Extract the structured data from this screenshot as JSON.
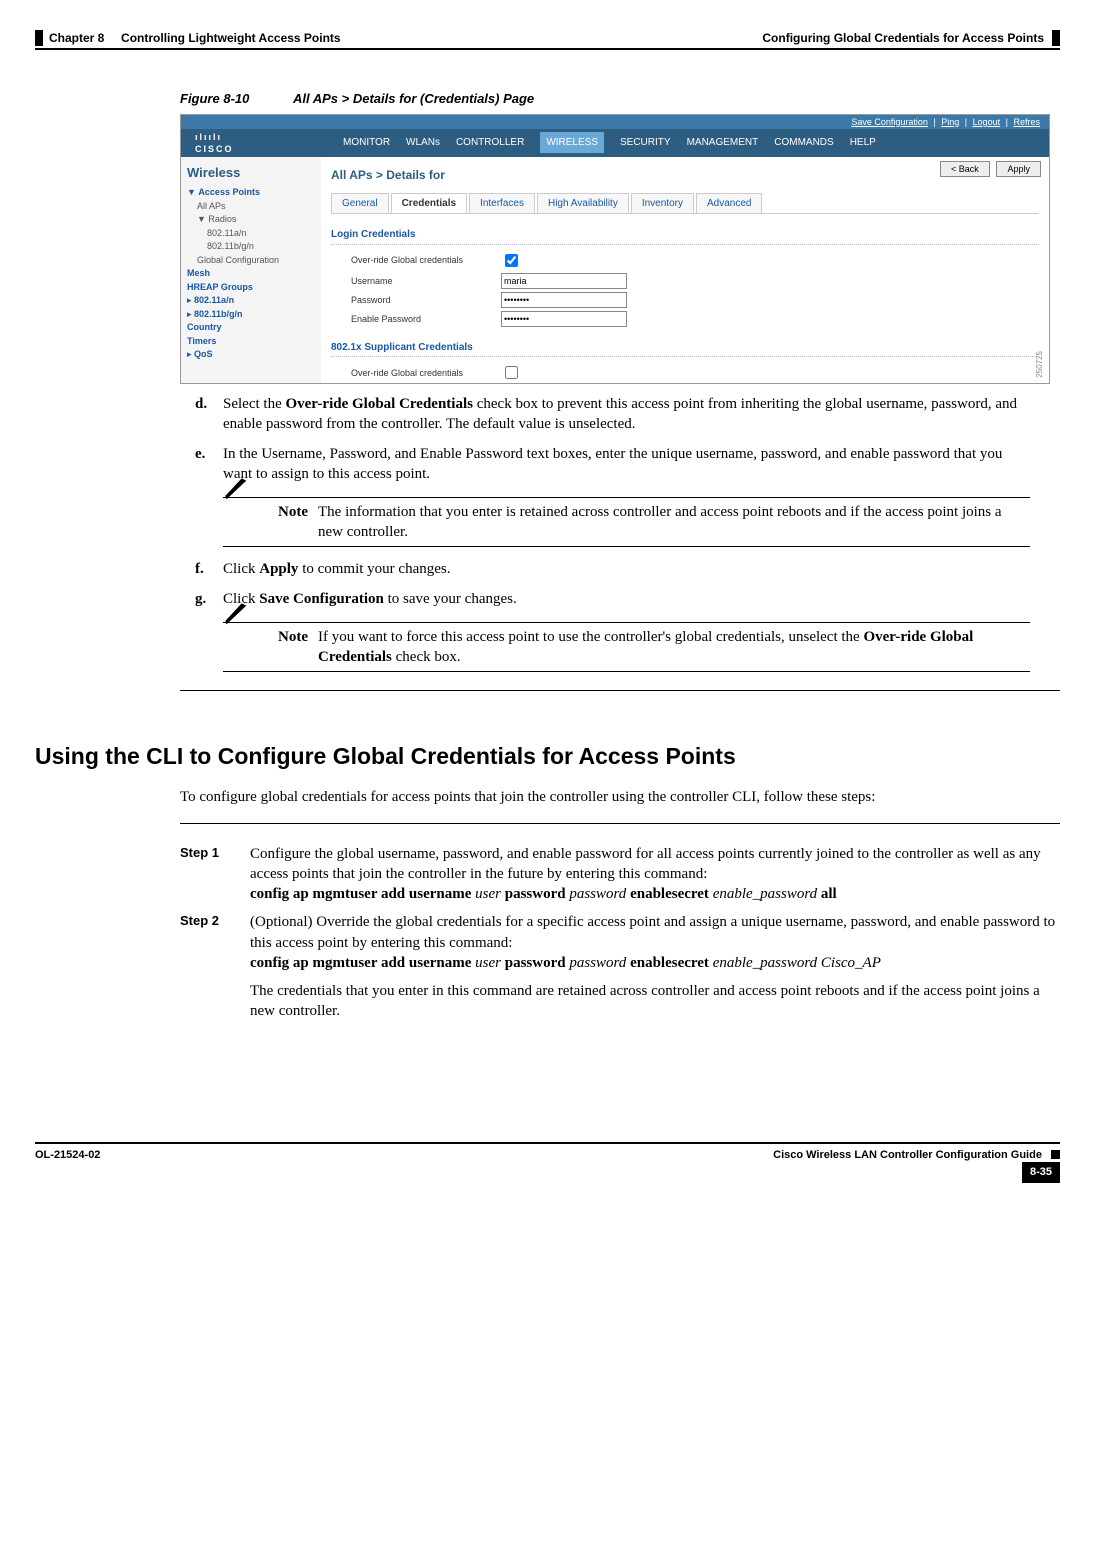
{
  "header": {
    "chapter_num": "Chapter 8",
    "chapter_title": "Controlling Lightweight Access Points",
    "section": "Configuring Global Credentials for Access Points"
  },
  "figure": {
    "label": "Figure 8-10",
    "title": "All APs > Details for (Credentials) Page",
    "image_id": "250725"
  },
  "screenshot": {
    "toplinks": [
      "Save Configuration",
      "Ping",
      "Logout",
      "Refres"
    ],
    "logo_top": "ılıılı",
    "logo_bot": "CISCO",
    "nav": [
      "MONITOR",
      "WLANs",
      "CONTROLLER",
      "WIRELESS",
      "SECURITY",
      "MANAGEMENT",
      "COMMANDS",
      "HELP"
    ],
    "nav_active": "WIRELESS",
    "side_title": "Wireless",
    "side": {
      "l0a": "Access Points",
      "l1a": "All APs",
      "l1b": "Radios",
      "l2a": "802.11a/n",
      "l2b": "802.11b/g/n",
      "l1c": "Global Configuration",
      "l0b": "Mesh",
      "l0c": "HREAP Groups",
      "l0d": "802.11a/n",
      "l0e": "802.11b/g/n",
      "l0f": "Country",
      "l0g": "Timers",
      "l0h": "QoS"
    },
    "crumb": "All APs > Details for",
    "btn_back": "< Back",
    "btn_apply": "Apply",
    "tabs": [
      "General",
      "Credentials",
      "Interfaces",
      "High Availability",
      "Inventory",
      "Advanced"
    ],
    "tab_active": "Credentials",
    "section1": "Login Credentials",
    "row_override": "Over-ride Global credentials",
    "row_user_lbl": "Username",
    "row_user_val": "maria",
    "row_pass_lbl": "Password",
    "row_pass_val": "••••••••",
    "row_en_lbl": "Enable Password",
    "row_en_val": "••••••••",
    "section2": "802.1x Supplicant Credentials",
    "row_override2": "Over-ride Global credentials"
  },
  "steps_letter": {
    "d": {
      "marker": "d.",
      "pre": "Select the ",
      "bold": "Over-ride Global Credentials",
      "post": " check box to prevent this access point from inheriting the global username, password, and enable password from the controller. The default value is unselected."
    },
    "e": {
      "marker": "e.",
      "text": "In the Username, Password, and Enable Password text boxes, enter the unique username, password, and enable password that you want to assign to this access point."
    },
    "f": {
      "marker": "f.",
      "pre": "Click ",
      "bold": "Apply",
      "post": " to commit your changes."
    },
    "g": {
      "marker": "g.",
      "pre": "Click ",
      "bold": "Save Configuration",
      "post": " to save your changes."
    }
  },
  "notes": {
    "label": "Note",
    "n1": "The information that you enter is retained across controller and access point reboots and if the access point joins a new controller.",
    "n2_pre": "If you want to force this access point to use the controller's global credentials, unselect the ",
    "n2_bold": "Over-ride Global Credentials",
    "n2_post": " check box."
  },
  "h2": "Using the CLI to Configure Global Credentials for Access Points",
  "cli_intro": "To configure global credentials for access points that join the controller using the controller CLI, follow these steps:",
  "cli_steps": {
    "s1": {
      "label": "Step 1",
      "para": "Configure the global username, password, and enable password for all access points currently joined to the controller as well as any access points that join the controller in the future by entering this command:",
      "cmd_b1": "config ap mgmtuser add username ",
      "cmd_i1": "user",
      "cmd_b2": " password ",
      "cmd_i2": "password",
      "cmd_b3": " enablesecret ",
      "cmd_i3": "enable_password",
      "cmd_b4": " all"
    },
    "s2": {
      "label": "Step 2",
      "para": "(Optional) Override the global credentials for a specific access point and assign a unique username, password, and enable password to this access point by entering this command:",
      "cmd_b1": "config ap mgmtuser add username ",
      "cmd_i1": "user",
      "cmd_b2": " password ",
      "cmd_i2": "password",
      "cmd_b3": " enablesecret ",
      "cmd_i3": "enable_password ",
      "cmd_i4": "Cisco_AP",
      "after": "The credentials that you enter in this command are retained across controller and access point reboots and if the access point joins a new controller."
    }
  },
  "footer": {
    "guide": "Cisco Wireless LAN Controller Configuration Guide",
    "doc": "OL-21524-02",
    "page": "8-35"
  }
}
